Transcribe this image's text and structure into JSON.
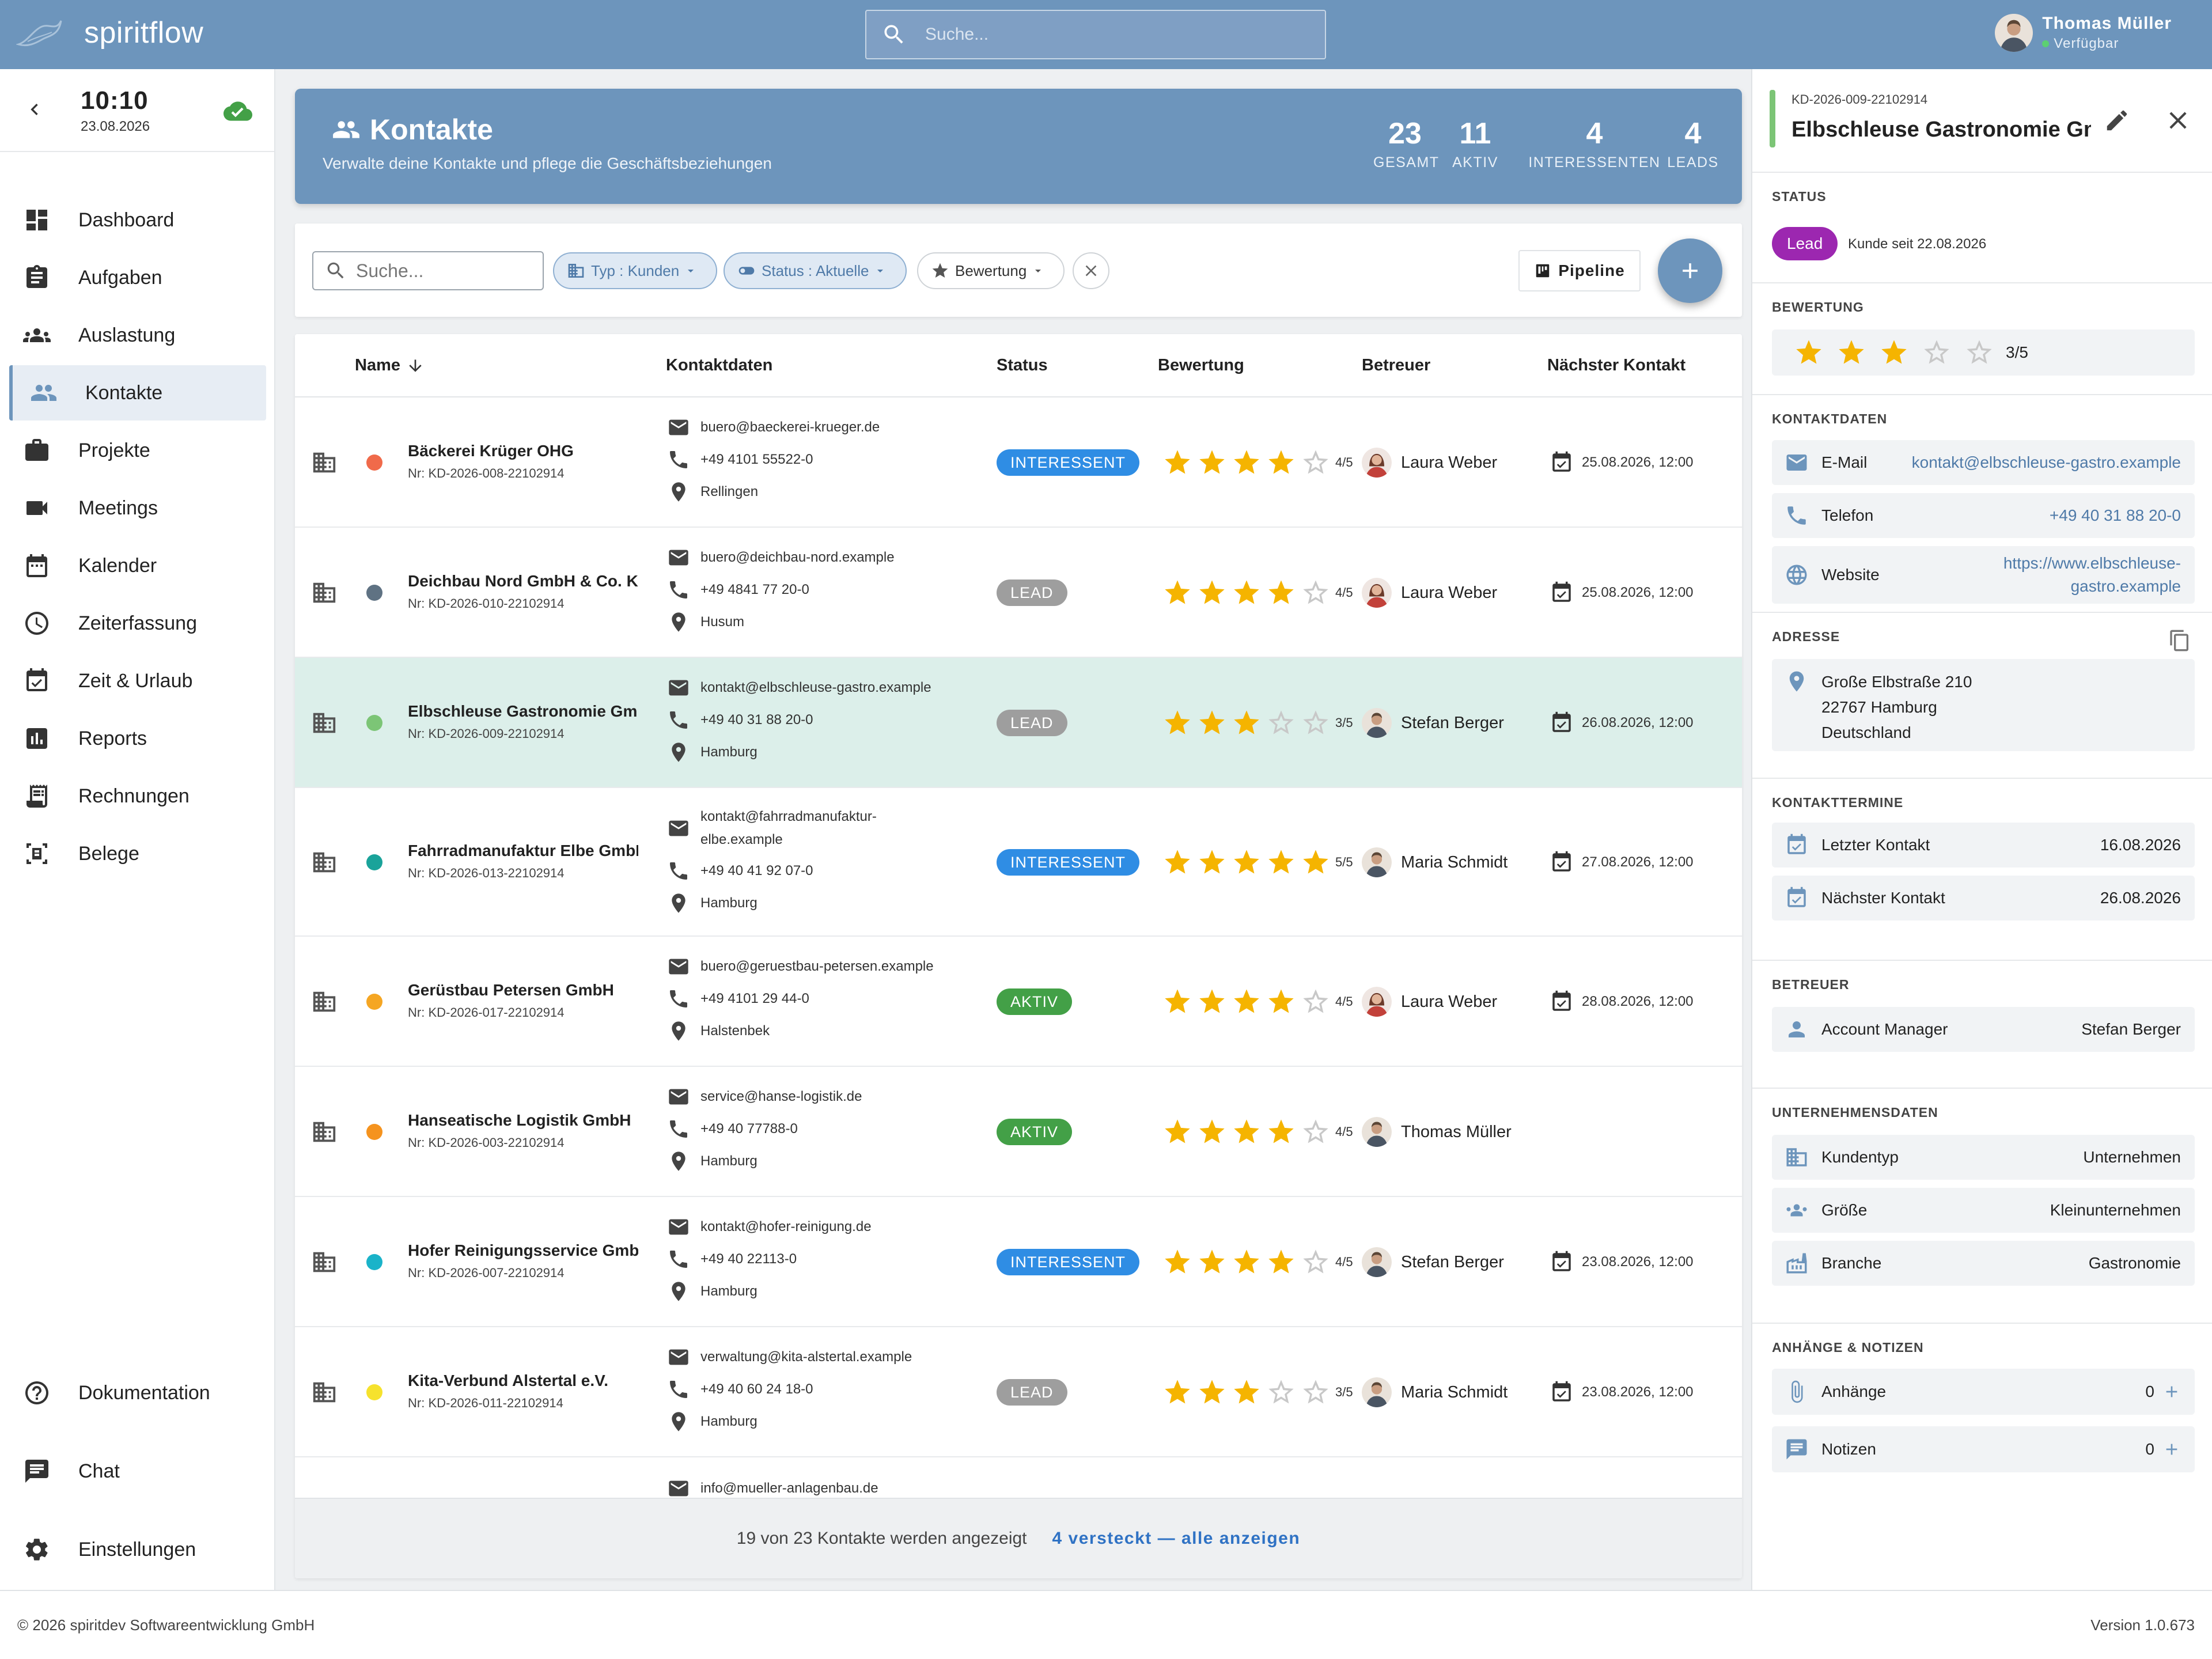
{
  "app": {
    "name": "spiritflow"
  },
  "topbar": {
    "search_placeholder": "Suche...",
    "user_name": "Thomas Müller",
    "user_status": "Verfügbar"
  },
  "clock": {
    "time": "10:10",
    "date": "23.08.2026"
  },
  "nav": {
    "items": [
      {
        "label": "Dashboard",
        "icon": "dashboard-icon"
      },
      {
        "label": "Aufgaben",
        "icon": "clipboard-icon"
      },
      {
        "label": "Auslastung",
        "icon": "groups-icon"
      },
      {
        "label": "Kontakte",
        "icon": "people-icon",
        "active": true
      },
      {
        "label": "Projekte",
        "icon": "briefcase-icon"
      },
      {
        "label": "Meetings",
        "icon": "video-icon"
      },
      {
        "label": "Kalender",
        "icon": "calendar-icon"
      },
      {
        "label": "Zeiterfassung",
        "icon": "clock-icon"
      },
      {
        "label": "Zeit & Urlaub",
        "icon": "event-check-icon"
      },
      {
        "label": "Reports",
        "icon": "bar-chart-icon"
      },
      {
        "label": "Rechnungen",
        "icon": "receipt-icon"
      },
      {
        "label": "Belege",
        "icon": "document-scan-icon"
      }
    ],
    "bottom": [
      {
        "label": "Dokumentation",
        "icon": "help-icon"
      },
      {
        "label": "Chat",
        "icon": "chat-icon"
      },
      {
        "label": "Einstellungen",
        "icon": "gear-icon"
      }
    ]
  },
  "header": {
    "title": "Kontakte",
    "subtitle": "Verwalte deine Kontakte und pflege die Geschäftsbeziehungen",
    "kpis": [
      {
        "value": "23",
        "label": "GESAMT"
      },
      {
        "value": "11",
        "label": "AKTIV"
      },
      {
        "value": "4",
        "label": "INTERESSENTEN"
      },
      {
        "value": "4",
        "label": "LEADS"
      }
    ]
  },
  "filters": {
    "search_placeholder": "Suche...",
    "type_chip": "Typ : Kunden",
    "status_chip": "Status : Aktuelle",
    "rating_chip": "Bewertung",
    "pipeline_label": "Pipeline"
  },
  "table": {
    "columns": [
      "Name",
      "Kontaktdaten",
      "Status",
      "Bewertung",
      "Betreuer",
      "Nächster Kontakt"
    ],
    "rows": [
      {
        "name": "Bäckerei Krüger OHG",
        "nr": "Nr: KD-2026-008-22102914",
        "dot": "#f06a4a",
        "email": "buero@baeckerei-krueger.de",
        "phone": "+49 4101 55522-0",
        "city": "Rellingen",
        "status": "INTERESSENT",
        "rating": 4,
        "rating_label": "4/5",
        "owner": "Laura Weber",
        "next": "25.08.2026, 12:00"
      },
      {
        "name": "Deichbau Nord GmbH & Co. KG",
        "nr": "Nr: KD-2026-010-22102914",
        "dot": "#5f7283",
        "email": "buero@deichbau-nord.example",
        "phone": "+49 4841 77 20-0",
        "city": "Husum",
        "status": "LEAD",
        "rating": 4,
        "rating_label": "4/5",
        "owner": "Laura Weber",
        "next": "25.08.2026, 12:00"
      },
      {
        "name": "Elbschleuse Gastronomie GmbH",
        "nr": "Nr: KD-2026-009-22102914",
        "dot": "#7cc576",
        "email": "kontakt@elbschleuse-gastro.example",
        "phone": "+49 40 31 88 20-0",
        "city": "Hamburg",
        "status": "LEAD",
        "rating": 3,
        "rating_label": "3/5",
        "owner": "Stefan Berger",
        "next": "26.08.2026, 12:00"
      },
      {
        "name": "Fahrradmanufaktur Elbe GmbH",
        "nr": "Nr: KD-2026-013-22102914",
        "dot": "#1aa39a",
        "email": "kontakt@fahrradmanufaktur-elbe.example",
        "email_line1": "kontakt@fahrradmanufaktur-",
        "email_line2": "elbe.example",
        "phone": "+49 40 41 92 07-0",
        "city": "Hamburg",
        "status": "INTERESSENT",
        "rating": 5,
        "rating_label": "5/5",
        "owner": "Maria Schmidt",
        "next": "27.08.2026, 12:00"
      },
      {
        "name": "Gerüstbau Petersen GmbH",
        "nr": "Nr: KD-2026-017-22102914",
        "dot": "#f5a623",
        "email": "buero@geruestbau-petersen.example",
        "phone": "+49 4101 29 44-0",
        "city": "Halstenbek",
        "status": "AKTIV",
        "rating": 4,
        "rating_label": "4/5",
        "owner": "Laura Weber",
        "next": "28.08.2026, 12:00"
      },
      {
        "name": "Hanseatische Logistik GmbH",
        "nr": "Nr: KD-2026-003-22102914",
        "dot": "#f5931e",
        "email": "service@hanse-logistik.de",
        "phone": "+49 40 77788-0",
        "city": "Hamburg",
        "status": "AKTIV",
        "rating": 4,
        "rating_label": "4/5",
        "owner": "Thomas Müller",
        "next": ""
      },
      {
        "name": "Hofer Reinigungsservice GmbH",
        "nr": "Nr: KD-2026-007-22102914",
        "dot": "#1ab3c9",
        "email": "kontakt@hofer-reinigung.de",
        "phone": "+49 40 22113-0",
        "city": "Hamburg",
        "status": "INTERESSENT",
        "rating": 4,
        "rating_label": "4/5",
        "owner": "Stefan Berger",
        "next": "23.08.2026, 12:00"
      },
      {
        "name": "Kita-Verbund Alstertal e.V.",
        "nr": "Nr: KD-2026-011-22102914",
        "dot": "#f6e22d",
        "email": "verwaltung@kita-alstertal.example",
        "phone": "+49 40 60 24 18-0",
        "city": "Hamburg",
        "status": "LEAD",
        "rating": 3,
        "rating_label": "3/5",
        "owner": "Maria Schmidt",
        "next": "23.08.2026, 12:00"
      },
      {
        "name": "",
        "nr": "",
        "dot": "",
        "email": "info@mueller-anlagenbau.de",
        "phone": "",
        "city": "",
        "status": "",
        "rating": 0,
        "rating_label": "",
        "owner": "",
        "next": ""
      }
    ],
    "footer_count": "19 von 23 Kontakte werden angezeigt",
    "footer_link": "4 versteckt — alle anzeigen"
  },
  "status_colors": {
    "INTERESSENT": "#2f8de4",
    "LEAD": "#9e9e9e",
    "AKTIV": "#43a047"
  },
  "detail": {
    "id": "KD-2026-009-22102914",
    "title": "Elbschleuse Gastronomie GmbH",
    "status_label": "STATUS",
    "status_badge": "Lead",
    "customer_since": "Kunde seit 22.08.2026",
    "rating_label": "BEWERTUNG",
    "rating": 3,
    "rating_text": "3/5",
    "contact_label": "KONTAKTDATEN",
    "email_key": "E-Mail",
    "email": "kontakt@elbschleuse-gastro.example",
    "phone_key": "Telefon",
    "phone": "+49 40 31 88 20-0",
    "website_key": "Website",
    "website": "https://www.elbschleuse-gastro.example",
    "website_line1": "https://www.elbschleuse-",
    "website_line2": "gastro.example",
    "address_label": "ADRESSE",
    "address_street": "Große Elbstraße 210",
    "address_city": "22767 Hamburg",
    "address_country": "Deutschland",
    "dates_label": "KONTAKTTERMINE",
    "last_key": "Letzter Kontakt",
    "last": "16.08.2026",
    "next_key": "Nächster Kontakt",
    "next": "26.08.2026",
    "owner_label": "BETREUER",
    "owner_key": "Account Manager",
    "owner": "Stefan Berger",
    "company_label": "UNTERNEHMENSDATEN",
    "type_key": "Kundentyp",
    "type": "Unternehmen",
    "size_key": "Größe",
    "size": "Kleinunternehmen",
    "branch_key": "Branche",
    "branch": "Gastronomie",
    "notes_label": "ANHÄNGE & NOTIZEN",
    "attach_key": "Anhänge",
    "attach": "0",
    "notes_key": "Notizen",
    "notes": "0"
  },
  "footer": {
    "copyright": "© 2026 spiritdev Softwareentwicklung GmbH",
    "version": "Version 1.0.673"
  }
}
